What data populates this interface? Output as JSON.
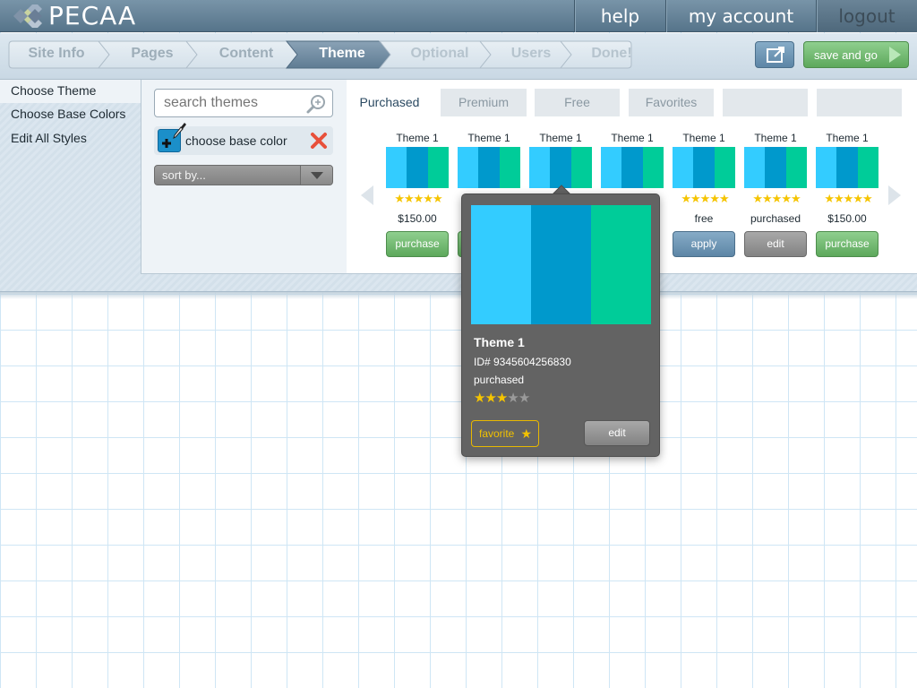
{
  "header": {
    "brand": "PECAA",
    "nav": {
      "help": "help",
      "account": "my account",
      "logout": "logout"
    }
  },
  "steps": [
    "Site Info",
    "Pages",
    "Content",
    "Theme",
    "Optional",
    "Users",
    "Done!"
  ],
  "active_step": "Theme",
  "toolbar": {
    "save_label": "save and go"
  },
  "left_menu": [
    "Choose Theme",
    "Choose Base Colors",
    "Edit All Styles"
  ],
  "search": {
    "placeholder": "search themes"
  },
  "base_color": {
    "label": "choose base color",
    "color": "#1b8fc9"
  },
  "sort": {
    "label": "sort by..."
  },
  "tabs": [
    "Purchased",
    "Premium",
    "Free",
    "Favorites",
    "",
    ""
  ],
  "active_tab": "Purchased",
  "colors": {
    "swatch": [
      "#33ccff",
      "#0099cc",
      "#00cc99"
    ],
    "star": "#f5c400",
    "purchase_button": "#5da85c",
    "apply_button": "#5d86a6",
    "edit_button": "#838383"
  },
  "themes": [
    {
      "name": "Theme 1",
      "rating": 5,
      "price": "$150.00",
      "action": "purchase"
    },
    {
      "name": "Theme 1",
      "rating": 5,
      "price": "",
      "action": ""
    },
    {
      "name": "Theme 1",
      "rating": 5,
      "price": "",
      "action": ""
    },
    {
      "name": "Theme 1",
      "rating": 5,
      "price": "",
      "action": ""
    },
    {
      "name": "Theme 1",
      "rating": 5,
      "price": "free",
      "action": "apply"
    },
    {
      "name": "Theme 1",
      "rating": 5,
      "price": "purchased",
      "action": "edit"
    },
    {
      "name": "Theme 1",
      "rating": 5,
      "price": "$150.00",
      "action": "purchase"
    }
  ],
  "popup": {
    "title": "Theme 1",
    "id": "ID# 9345604256830",
    "status": "purchased",
    "rating": 3,
    "rating_max": 5,
    "favorite_label": "favorite",
    "edit_label": "edit"
  }
}
